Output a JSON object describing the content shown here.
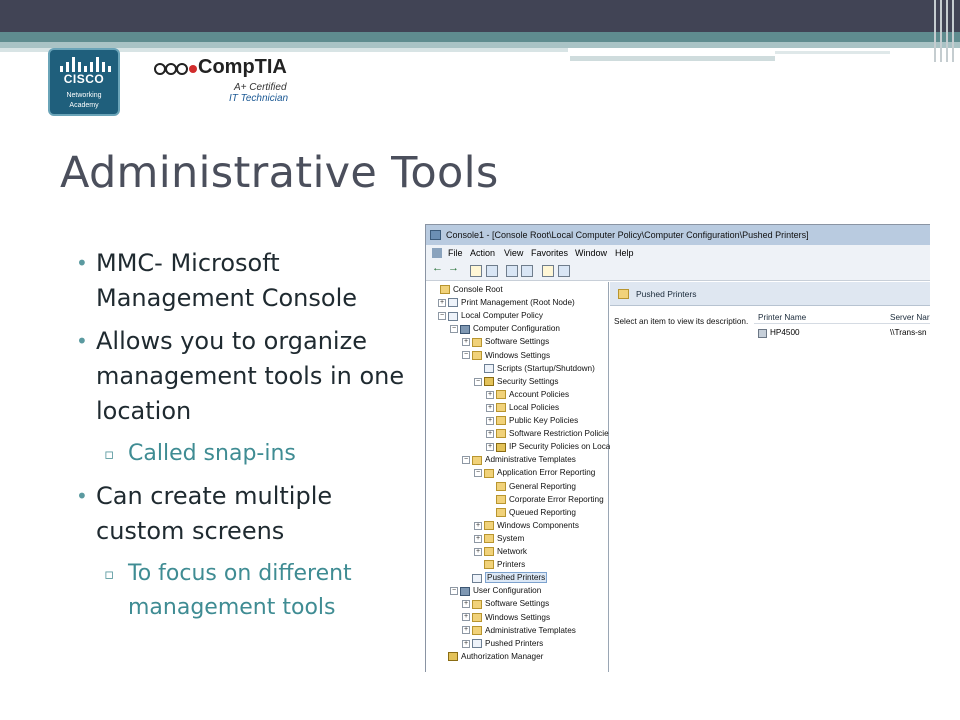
{
  "slide": {
    "title": "Administrative Tools",
    "logos": {
      "cisco": {
        "word": "CISCO",
        "caption_line1": "Networking",
        "caption_line2": "Academy"
      },
      "comptia": {
        "name": "CompTIA",
        "cert_line1": "A+ Certified",
        "cert_line2": "IT Technician"
      }
    },
    "bullets": [
      {
        "level": 1,
        "text": "MMC- Microsoft Management Console"
      },
      {
        "level": 1,
        "text": "Allows you to organize management tools in one location"
      },
      {
        "level": 2,
        "text": "Called snap-ins"
      },
      {
        "level": 1,
        "text": "Can create multiple custom screens"
      },
      {
        "level": 2,
        "text": "To focus on different management tools"
      }
    ],
    "colors": {
      "title": "#4b4f5c",
      "accent": "#3f8c93",
      "topbar": "#414455"
    }
  },
  "mmc": {
    "title": "Console1 - [Console Root\\Local Computer Policy\\Computer Configuration\\Pushed Printers]",
    "menu": [
      "File",
      "Action",
      "View",
      "Favorites",
      "Window",
      "Help"
    ],
    "tree": [
      {
        "label": "Console Root",
        "icon": "folder-icon",
        "expand": ""
      },
      {
        "label": "Print Management (Root Node)",
        "icon": "printer-icon",
        "expand": "+"
      },
      {
        "label": "Local Computer Policy",
        "icon": "policy-icon",
        "expand": "-"
      },
      {
        "label": "Computer Configuration",
        "icon": "computer-icon",
        "expand": "-"
      },
      {
        "label": "Software Settings",
        "icon": "folder-icon",
        "expand": "+"
      },
      {
        "label": "Windows Settings",
        "icon": "folder-icon",
        "expand": "-"
      },
      {
        "label": "Scripts (Startup/Shutdown)",
        "icon": "script-icon",
        "expand": ""
      },
      {
        "label": "Security Settings",
        "icon": "security-icon",
        "expand": "-"
      },
      {
        "label": "Account Policies",
        "icon": "folder-icon",
        "expand": "+"
      },
      {
        "label": "Local Policies",
        "icon": "folder-icon",
        "expand": "+"
      },
      {
        "label": "Public Key Policies",
        "icon": "folder-icon",
        "expand": "+"
      },
      {
        "label": "Software Restriction Policie",
        "icon": "folder-icon",
        "expand": "+"
      },
      {
        "label": "IP Security Policies on Loca",
        "icon": "security-icon",
        "expand": "+"
      },
      {
        "label": "Administrative Templates",
        "icon": "folder-icon",
        "expand": "-"
      },
      {
        "label": "Application Error Reporting",
        "icon": "folder-icon",
        "expand": "-"
      },
      {
        "label": "General Reporting",
        "icon": "folder-icon",
        "expand": ""
      },
      {
        "label": "Corporate Error Reporting",
        "icon": "folder-icon",
        "expand": ""
      },
      {
        "label": "Queued Reporting",
        "icon": "folder-icon",
        "expand": ""
      },
      {
        "label": "Windows Components",
        "icon": "folder-icon",
        "expand": "+"
      },
      {
        "label": "System",
        "icon": "folder-icon",
        "expand": "+"
      },
      {
        "label": "Network",
        "icon": "folder-icon",
        "expand": "+"
      },
      {
        "label": "Printers",
        "icon": "folder-icon",
        "expand": ""
      },
      {
        "label": "Pushed Printers",
        "icon": "printer-icon",
        "expand": ""
      },
      {
        "label": "User Configuration",
        "icon": "user-icon",
        "expand": "-"
      },
      {
        "label": "Software Settings",
        "icon": "folder-icon",
        "expand": "+"
      },
      {
        "label": "Windows Settings",
        "icon": "folder-icon",
        "expand": "+"
      },
      {
        "label": "Administrative Templates",
        "icon": "folder-icon",
        "expand": "+"
      },
      {
        "label": "Pushed Printers",
        "icon": "printer-icon",
        "expand": "+"
      },
      {
        "label": "Authorization Manager",
        "icon": "authorization-icon",
        "expand": ""
      }
    ],
    "detail": {
      "header": "Pushed Printers",
      "description": "Select an item to view its description.",
      "columns": [
        "Printer Name",
        "Server Nar"
      ],
      "rows": [
        {
          "printer": "HP4500",
          "server": "\\\\Trans-sn"
        }
      ]
    }
  }
}
